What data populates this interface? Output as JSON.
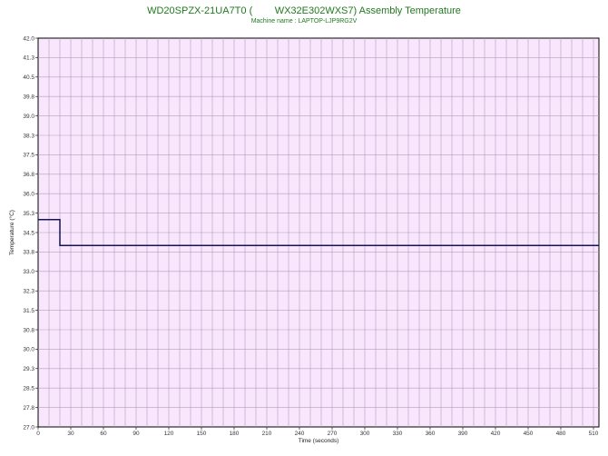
{
  "chart_data": {
    "type": "line",
    "title": "WD20SPZX-21UA7T0 (        WX32E302WXS7) Assembly Temperature",
    "subtitle": "Machine name : LAPTOP-LJP9RG2V",
    "xlabel": "Time (seconds)",
    "ylabel": "Temperature (°C)",
    "xlim": [
      0,
      515
    ],
    "ylim": [
      27.0,
      42.0
    ],
    "x_ticks": [
      0,
      30,
      60,
      90,
      120,
      150,
      180,
      210,
      240,
      270,
      300,
      330,
      360,
      390,
      420,
      450,
      480,
      510
    ],
    "y_ticks": [
      "42.0",
      "41.3",
      "40.5",
      "39.8",
      "39.0",
      "38.3",
      "37.5",
      "36.8",
      "36.0",
      "35.3",
      "34.5",
      "33.8",
      "33.0",
      "32.3",
      "31.5",
      "30.8",
      "30.0",
      "29.3",
      "28.5",
      "27.8",
      "27.0"
    ],
    "grid": true,
    "colors": {
      "background": "#f8e6fc",
      "grid": "#b79bc0",
      "line": "#14145a"
    },
    "series": [
      {
        "x": [
          0,
          20,
          20,
          515
        ],
        "values": [
          35.0,
          35.0,
          34.0,
          34.0
        ]
      }
    ]
  }
}
